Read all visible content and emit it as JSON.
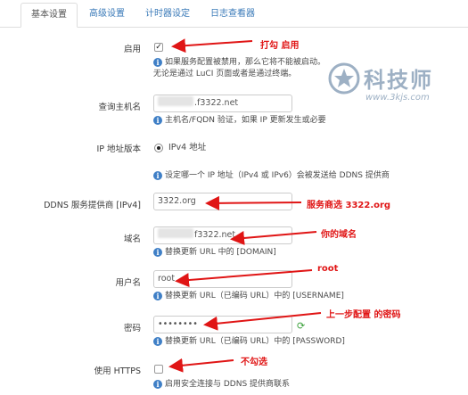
{
  "tabs": [
    {
      "label": "基本设置",
      "active": true
    },
    {
      "label": "高级设置",
      "active": false
    },
    {
      "label": "计时器设定",
      "active": false
    },
    {
      "label": "日志查看器",
      "active": false
    }
  ],
  "fields": {
    "enable": {
      "label": "启用",
      "checked": true,
      "hint_line1": "如果服务配置被禁用，那么它将不能被启动。",
      "hint_line2": "无论是通过 LuCI 页面或者是通过终端。"
    },
    "lookup_host": {
      "label": "查询主机名",
      "value": ".f3322.net",
      "hint": "主机名/FQDN 验证，如果 IP 更新发生或必要"
    },
    "ip_version": {
      "label": "IP 地址版本",
      "option": "IPv4 地址",
      "hint": "设定哪一个 IP 地址（IPv4 或 IPv6）会被发送给 DDNS 提供商"
    },
    "provider": {
      "label": "DDNS 服务提供商 [IPv4]",
      "value": "3322.org"
    },
    "domain": {
      "label": "域名",
      "value": "f3322.net",
      "hint": "替换更新 URL 中的 [DOMAIN]"
    },
    "username": {
      "label": "用户名",
      "value": "root",
      "hint": "替换更新 URL（已编码 URL）中的 [USERNAME]"
    },
    "password": {
      "label": "密码",
      "value": "••••••••",
      "hint": "替换更新 URL（已编码 URL）中的 [PASSWORD]"
    },
    "https": {
      "label": "使用 HTTPS",
      "checked": false,
      "hint": "启用安全连接与 DDNS 提供商联系"
    }
  },
  "annotations": {
    "enable": "打勾 启用",
    "provider": "服务商选 3322.org",
    "domain": "你的域名",
    "username": "root",
    "password": "上一步配置 的密码",
    "https": "不勾选"
  },
  "info_glyph": "i",
  "watermark": {
    "text": "科技师",
    "url": "www.3kjs.com",
    "icon": "star-shield-icon"
  },
  "colors": {
    "annotation": "#e01515",
    "link": "#3a7ab8",
    "info": "#3f7fc6"
  }
}
